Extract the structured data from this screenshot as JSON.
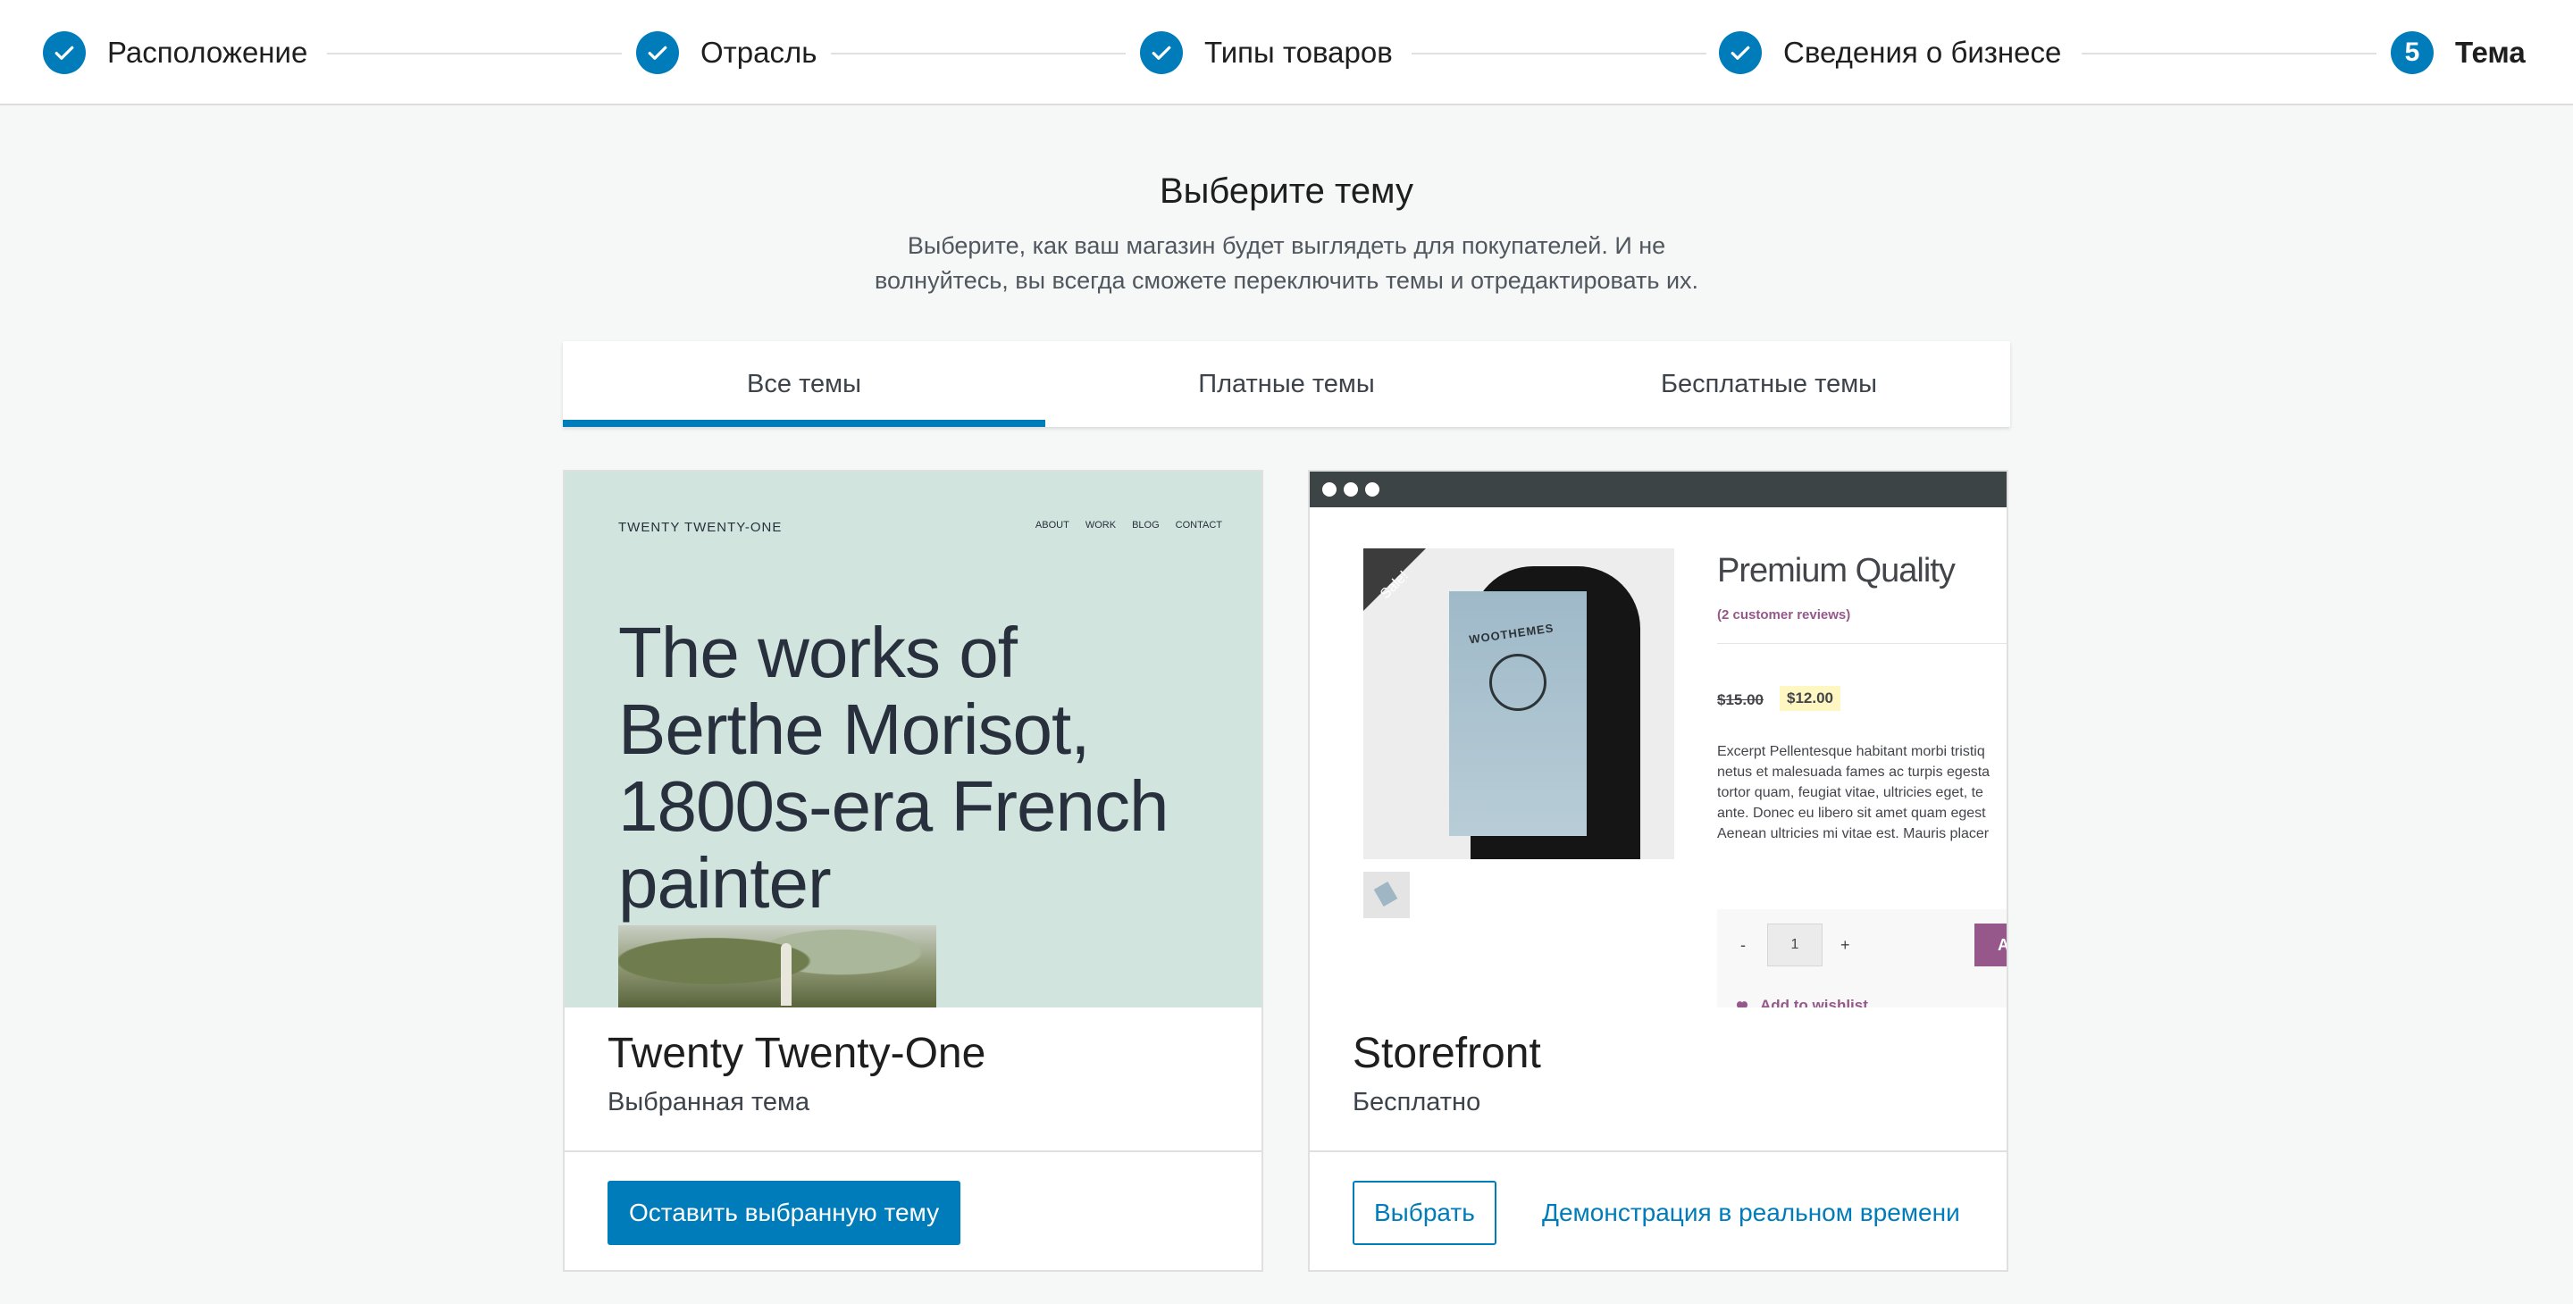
{
  "stepper": {
    "steps": [
      {
        "label": "Расположение",
        "state": "done"
      },
      {
        "label": "Отрасль",
        "state": "done"
      },
      {
        "label": "Типы товаров",
        "state": "done"
      },
      {
        "label": "Сведения о бизнесе",
        "state": "done"
      },
      {
        "label": "Тема",
        "number": "5",
        "state": "current"
      }
    ]
  },
  "heading": {
    "title": "Выберите тему",
    "subtitle": "Выберите, как ваш магазин будет выглядеть для покупателей. И не волнуйтесь, вы всегда сможете переключить темы и отредактировать их."
  },
  "tabs": [
    {
      "label": "Все темы",
      "active": true
    },
    {
      "label": "Платные темы",
      "active": false
    },
    {
      "label": "Бесплатные темы",
      "active": false
    }
  ],
  "themes": [
    {
      "name": "Twenty Twenty-One",
      "status": "Выбранная тема",
      "primary_button": "Оставить выбранную тему",
      "preview": {
        "site_title": "TWENTY TWENTY-ONE",
        "nav": [
          "ABOUT",
          "WORK",
          "BLOG",
          "CONTACT"
        ],
        "hero": "The works of Berthe Morisot, 1800s-era French painter"
      }
    },
    {
      "name": "Storefront",
      "status": "Бесплатно",
      "select_button": "Выбрать",
      "demo_link": "Демонстрация в реальном времени",
      "preview": {
        "sale_badge": "Sale!",
        "poster_text": "WOOTHEMES",
        "product_title": "Premium Quality",
        "reviews": "(2 customer reviews)",
        "old_price": "$15.00",
        "new_price": "$12.00",
        "description": [
          "Excerpt Pellentesque habitant morbi tristiq",
          "netus et malesuada fames ac turpis egesta",
          "tortor quam, feugiat vitae, ultricies eget, te",
          "ante. Donec eu libero sit amet quam egest",
          "Aenean ultricies mi vitae est. Mauris placer"
        ],
        "qty_minus": "-",
        "qty_value": "1",
        "qty_plus": "+",
        "add_to_cart": "Ad",
        "wishlist": "Add to wishlist"
      }
    }
  ],
  "colors": {
    "accent": "#007cba",
    "page_bg": "#f6f7f7",
    "tt1_bg": "#d1e4dd",
    "storefront_purple": "#96588a"
  },
  "icons": {
    "step_done": "checkmark-icon",
    "wishlist": "heart-icon"
  }
}
